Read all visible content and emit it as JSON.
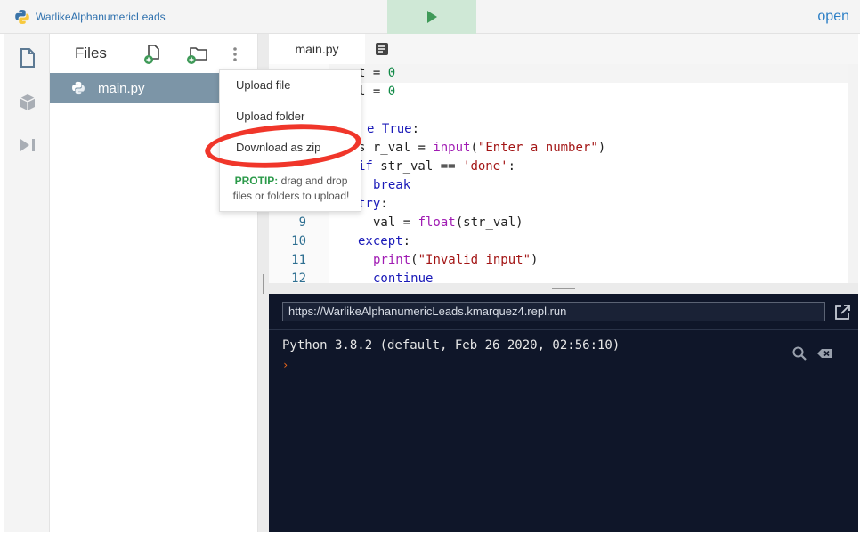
{
  "topbar": {
    "repl_name": "WarlikeAlphanumericLeads",
    "open_label": "open"
  },
  "files_panel": {
    "title": "Files",
    "files": [
      {
        "name": "main.py"
      }
    ]
  },
  "file_menu": {
    "items": [
      "Upload file",
      "Upload folder",
      "Download as zip"
    ],
    "protip_label": "PROTIP:",
    "protip_text": "drag and drop files or folders to upload!"
  },
  "editor": {
    "tab": "main.py",
    "line_numbers": [
      "9",
      "10",
      "11",
      "12"
    ]
  },
  "console": {
    "url": "https://WarlikeAlphanumericLeads.kmarquez4.repl.run",
    "output": "Python 3.8.2 (default, Feb 26 2020, 02:56:10)",
    "prompt": "›"
  },
  "colors": {
    "accent": "#f0362a",
    "run": "#3f9a58",
    "console_bg": "#0f1629",
    "selected_file": "#7c95a7"
  },
  "icons": {
    "rail": [
      "file-icon",
      "package-icon",
      "debugger-icon"
    ],
    "files_actions": [
      "add-file-icon",
      "add-folder-icon",
      "more-icon"
    ],
    "console": [
      "search-icon",
      "clear-icon",
      "external-link-icon"
    ]
  }
}
